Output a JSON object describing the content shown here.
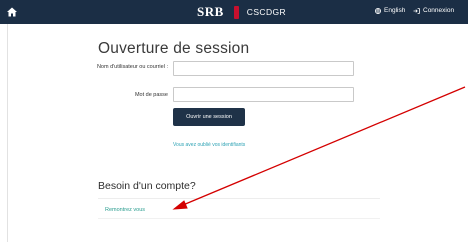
{
  "header": {
    "brand_logo": "SRB",
    "brand_name": "CSCDGR",
    "language": "English",
    "login": "Connexion"
  },
  "login": {
    "title": "Ouverture de session",
    "username_label": "Nom d'utilisateur ou courriel :",
    "username_value": "",
    "password_label": "Mot de passe",
    "password_value": "",
    "submit_label": "Ouvrir une session",
    "forgot_link": "Vous avez oublié vos identifiants"
  },
  "account": {
    "title": "Besoin d'un compte?",
    "register_link": "Remontrez vous"
  },
  "colors": {
    "header_bg": "#1b2e45",
    "button_bg": "#1f3248",
    "link": "#2fa3b5",
    "annotation_arrow": "#d40000"
  }
}
